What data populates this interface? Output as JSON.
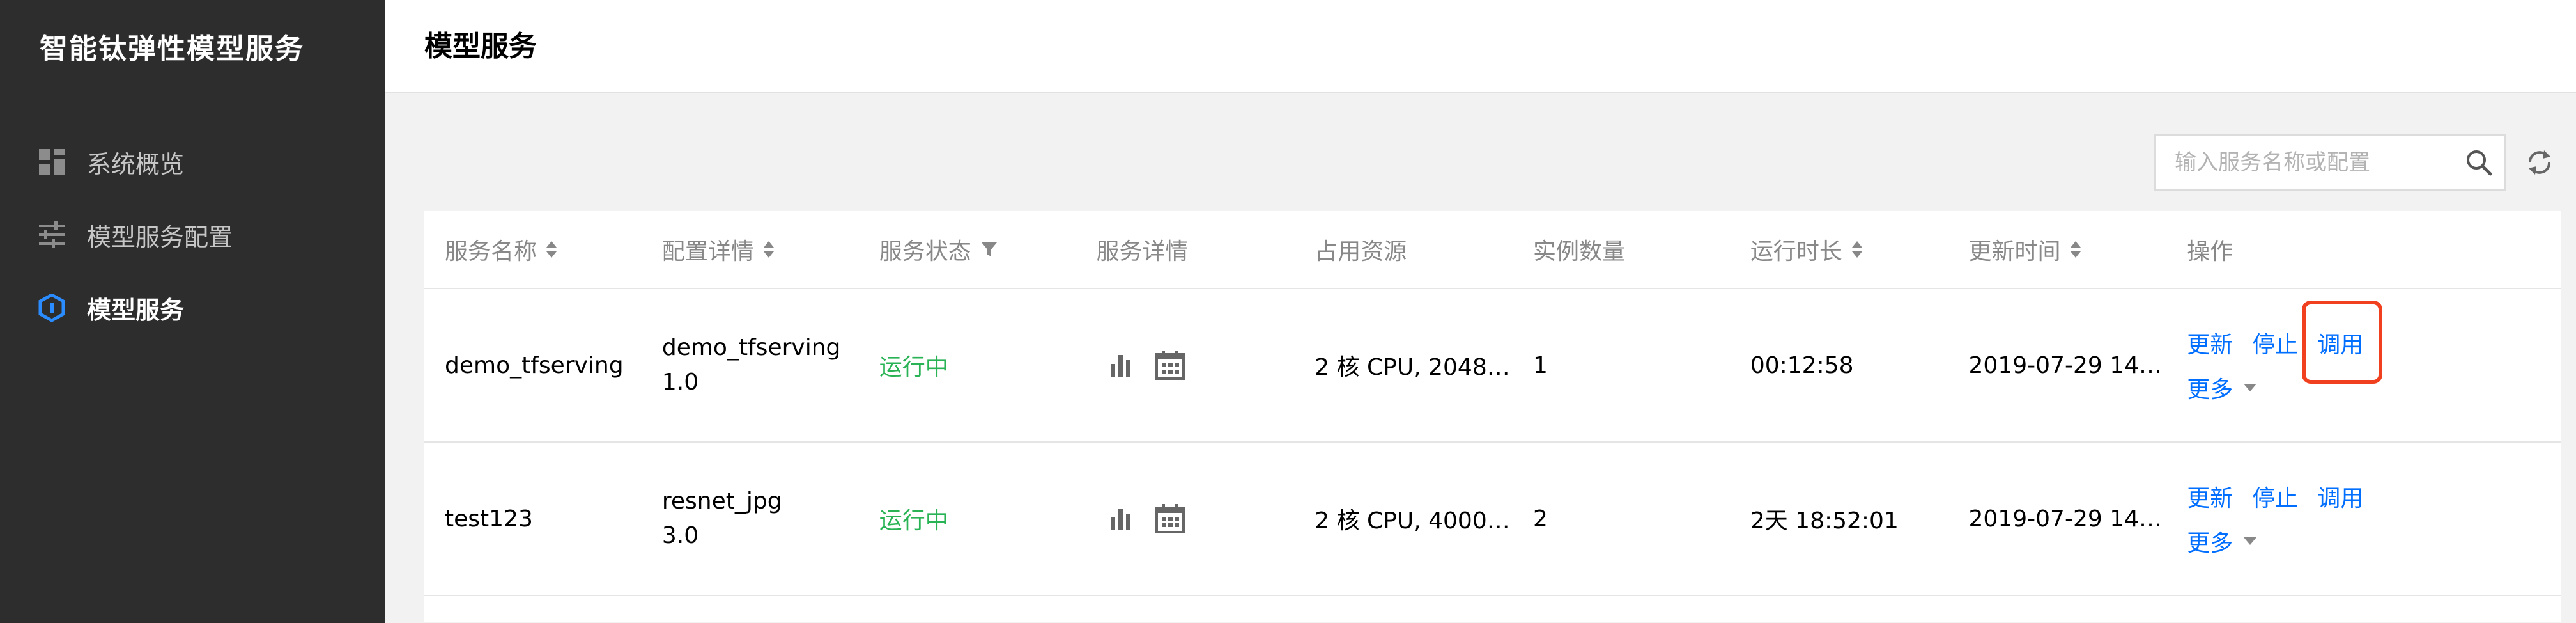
{
  "sidebar": {
    "brand": "智能钛弹性模型服务",
    "items": [
      {
        "label": "系统概览",
        "icon": "dashboard-icon",
        "active": false
      },
      {
        "label": "模型服务配置",
        "icon": "sliders-icon",
        "active": false
      },
      {
        "label": "模型服务",
        "icon": "model-service-icon",
        "active": true
      }
    ]
  },
  "header": {
    "title": "模型服务"
  },
  "search": {
    "placeholder": "输入服务名称或配置",
    "value": ""
  },
  "table": {
    "columns": [
      "服务名称",
      "配置详情",
      "服务状态",
      "服务详情",
      "占用资源",
      "实例数量",
      "运行时长",
      "更新时间",
      "操作"
    ],
    "rows": [
      {
        "name": "demo_tfserving",
        "config_name": "demo_tfserving",
        "config_version": "1.0",
        "status": "运行中",
        "resources": "2 核 CPU, 2048…",
        "instances": "1",
        "runtime": "00:12:58",
        "updated": "2019-07-29 14:…",
        "actions": {
          "update": "更新",
          "stop": "停止",
          "invoke": "调用",
          "more": "更多"
        }
      },
      {
        "name": "test123",
        "config_name": "resnet_jpg",
        "config_version": "3.0",
        "status": "运行中",
        "resources": "2 核 CPU, 4000…",
        "instances": "2",
        "runtime": "2天 18:52:01",
        "updated": "2019-07-29 14:…",
        "actions": {
          "update": "更新",
          "stop": "停止",
          "invoke": "调用",
          "more": "更多"
        }
      }
    ]
  },
  "colors": {
    "sidebar_bg": "#2d2d2d",
    "accent": "#006eff",
    "status_running": "#29b355",
    "highlight": "#f0401f"
  }
}
